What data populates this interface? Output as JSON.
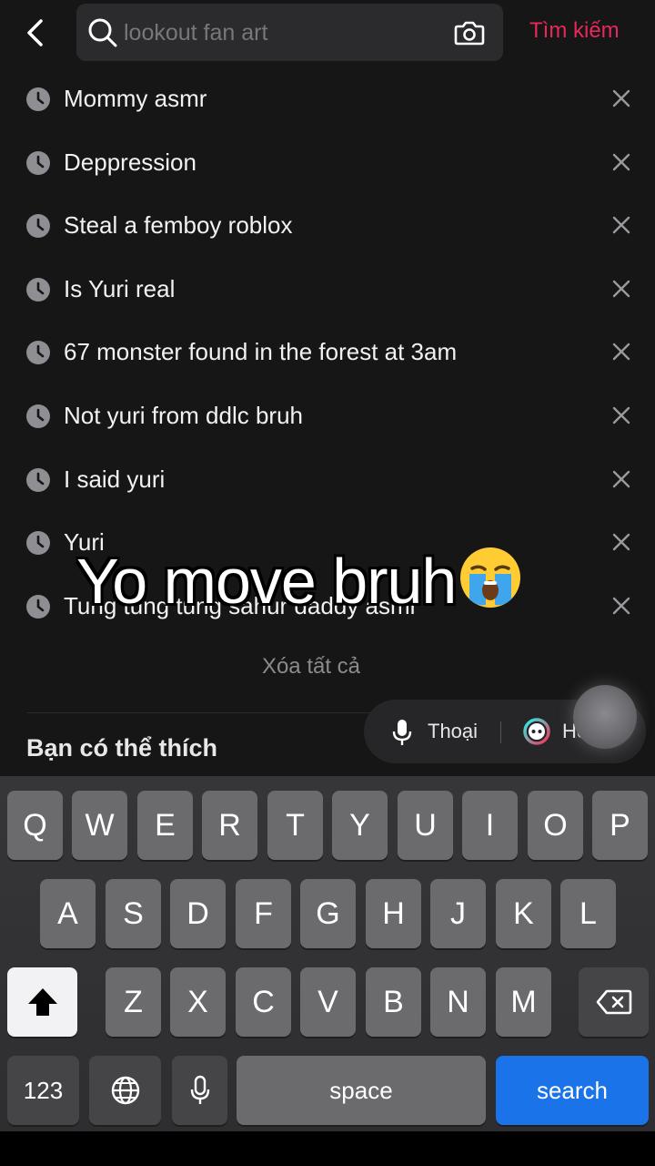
{
  "header": {
    "search_value": "",
    "search_placeholder": "lookout fan art",
    "search_button_label": "Tìm kiếm"
  },
  "history": [
    {
      "label": "Mommy asmr"
    },
    {
      "label": "Deppression"
    },
    {
      "label": "Steal a femboy roblox"
    },
    {
      "label": "Is Yuri real"
    },
    {
      "label": "67 monster found in the forest at 3am"
    },
    {
      "label": "Not yuri from ddlc bruh"
    },
    {
      "label": "I said yuri"
    },
    {
      "label": "Yuri"
    },
    {
      "label": "Tung tung tung sahur daddy asmr"
    }
  ],
  "clear_all_label": "Xóa tất cả",
  "section_title": "Bạn có thể thích",
  "voice_ai_pill": {
    "voice_label": "Thoại",
    "ai_label": "Hỏi AI"
  },
  "overlay_caption": "Yo move bruh",
  "overlay_emoji": "loudly-crying-face",
  "keyboard": {
    "row1": [
      "Q",
      "W",
      "E",
      "R",
      "T",
      "Y",
      "U",
      "I",
      "O",
      "P"
    ],
    "row2": [
      "A",
      "S",
      "D",
      "F",
      "G",
      "H",
      "J",
      "K",
      "L"
    ],
    "row3": [
      "Z",
      "X",
      "C",
      "V",
      "B",
      "N",
      "M"
    ],
    "numbers_label": "123",
    "space_label": "space",
    "search_label": "search"
  },
  "colors": {
    "accent": "#e8275a",
    "background": "#161616",
    "keyboard_action": "#1a73e8"
  }
}
